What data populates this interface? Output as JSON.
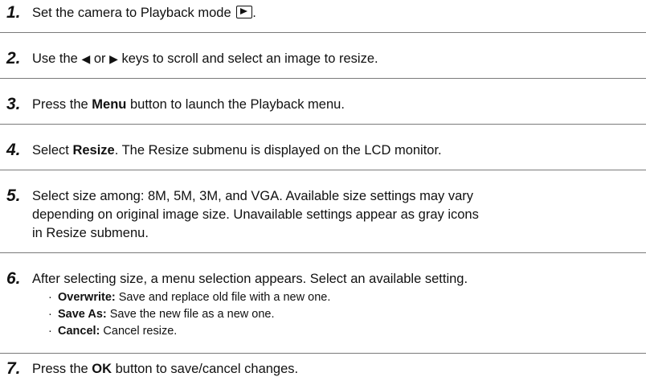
{
  "steps": [
    {
      "number": "1.",
      "before_icon": "Set the camera to Playback mode ",
      "icon": "playback-icon",
      "after_icon": "."
    },
    {
      "number": "2.",
      "text_a": "Use the ",
      "left_arrow": "◀",
      "text_b": " or ",
      "right_arrow": "▶",
      "text_c": " keys to scroll and select an image to resize."
    },
    {
      "number": "3.",
      "text_a": "Press the ",
      "bold": "Menu",
      "text_b": " button to launch the Playback menu."
    },
    {
      "number": "4.",
      "text_a": "Select ",
      "bold": "Resize",
      "text_b": ". The Resize submenu is displayed on the LCD monitor."
    },
    {
      "number": "5.",
      "lines": [
        "Select size among: 8M, 5M, 3M, and VGA. Available size settings may vary",
        "depending on original image size. Unavailable settings appear as gray icons",
        "in Resize submenu."
      ]
    },
    {
      "number": "6.",
      "text": "After selecting size, a menu selection appears. Select an available setting.",
      "bullets": [
        {
          "bold": "Overwrite:",
          "text": " Save and replace old file with a new one."
        },
        {
          "bold": "Save As:",
          "text": " Save the new file as a new one."
        },
        {
          "bold": "Cancel:",
          "text": " Cancel resize."
        }
      ]
    },
    {
      "number": "7.",
      "text_a": "Press the ",
      "bold": "OK",
      "text_b": " button to save/cancel changes."
    }
  ]
}
